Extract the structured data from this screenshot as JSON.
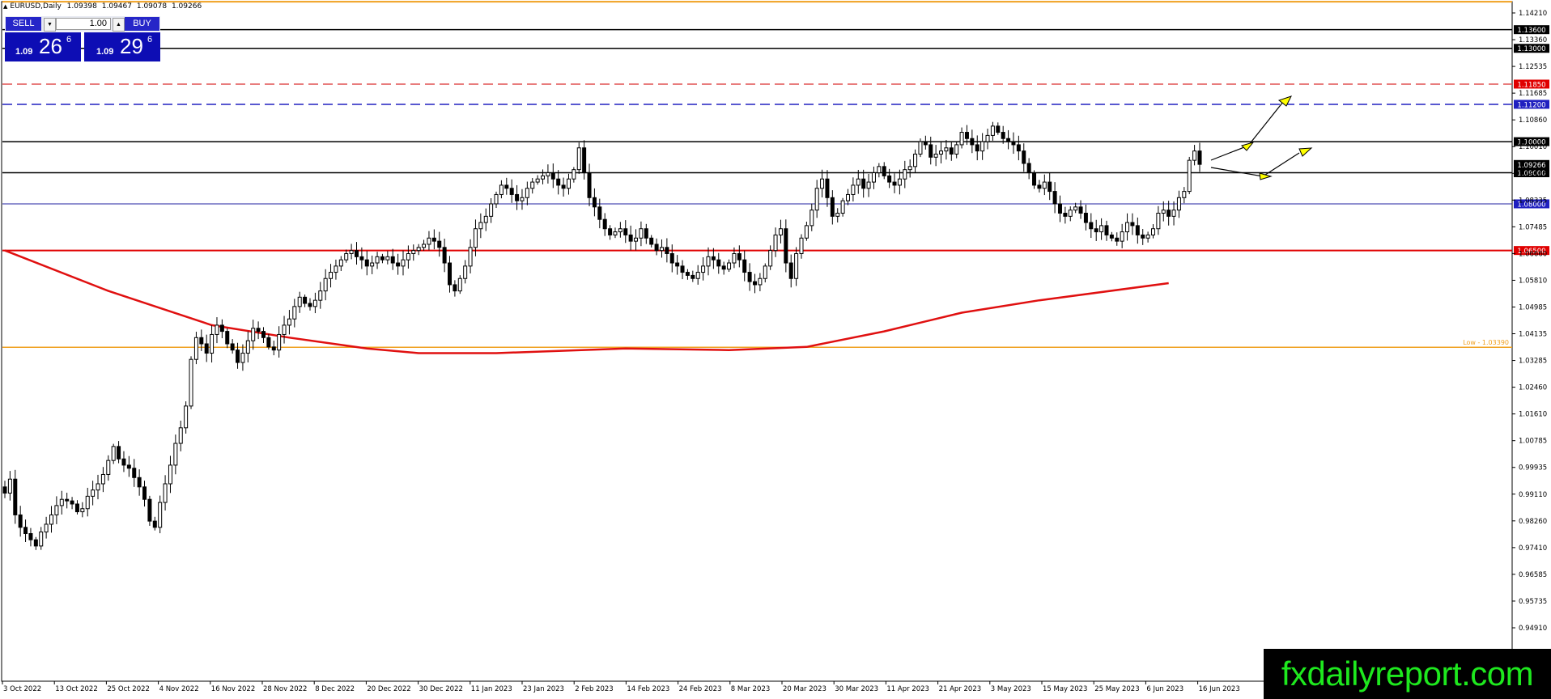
{
  "header": {
    "symbol": "EURUSD,Daily",
    "open": "1.09398",
    "high": "1.09467",
    "low": "1.09078",
    "close": "1.09266"
  },
  "trade_panel": {
    "sell_label": "SELL",
    "buy_label": "BUY",
    "lot_value": "1.00",
    "sell_big": "1.09",
    "sell_pips": "26",
    "sell_sup": "6",
    "buy_big": "1.09",
    "buy_pips": "29",
    "buy_sup": "6"
  },
  "watermark": "fxdailyreport.com",
  "colors": {
    "candle_up": "#ffffff",
    "candle_down": "#000000",
    "ma_line": "#e01010",
    "support_red": "#e00000",
    "dashed_red": "#e05050",
    "dashed_blue": "#2020c0",
    "blue_line": "#2020a0",
    "orange_line": "#f0a020",
    "arrow_fill": "#ffff00",
    "label_red": "#e00000",
    "label_blue": "#2020c0"
  },
  "chart_data": {
    "type": "candlestick",
    "ylim": [
      0.944,
      1.146
    ],
    "y_ticks": [
      "1.14210",
      "1.13360",
      "1.12535",
      "1.11685",
      "1.10860",
      "1.10010",
      "1.09185",
      "1.08335",
      "1.07485",
      "1.06660",
      "1.05810",
      "1.04985",
      "1.04135",
      "1.03285",
      "1.02460",
      "1.01610",
      "1.00785",
      "0.99935",
      "0.99110",
      "0.98260",
      "0.97410",
      "0.96585",
      "0.95735",
      "0.94910"
    ],
    "x_labels": [
      "3 Oct 2022",
      "13 Oct 2022",
      "25 Oct 2022",
      "4 Nov 2022",
      "16 Nov 2022",
      "28 Nov 2022",
      "8 Dec 2022",
      "20 Dec 2022",
      "30 Dec 2022",
      "11 Jan 2023",
      "23 Jan 2023",
      "2 Feb 2023",
      "14 Feb 2023",
      "24 Feb 2023",
      "8 Mar 2023",
      "20 Mar 2023",
      "30 Mar 2023",
      "11 Apr 2023",
      "21 Apr 2023",
      "3 May 2023",
      "15 May 2023",
      "25 May 2023",
      "6 Jun 2023",
      "16 Jun 2023"
    ],
    "levels": [
      {
        "value": 1.145,
        "label": "",
        "style": "orange-top"
      },
      {
        "value": 1.136,
        "label": "1.13600",
        "style": "black"
      },
      {
        "value": 1.13,
        "label": "1.13000",
        "style": "black"
      },
      {
        "value": 1.1185,
        "label": "1.11850",
        "style": "dashed-red"
      },
      {
        "value": 1.112,
        "label": "1.11200",
        "style": "dashed-blue"
      },
      {
        "value": 1.1,
        "label": "1.10000",
        "style": "black"
      },
      {
        "value": 1.09,
        "label": "1.09000",
        "style": "black"
      },
      {
        "value": 1.08,
        "label": "1.08000",
        "style": "blue"
      },
      {
        "value": 1.065,
        "label": "1.06500",
        "style": "red"
      },
      {
        "value": 1.0339,
        "label": "Low - 1.03390",
        "style": "orange"
      }
    ],
    "current_price": "1.09266",
    "current_price_value": 1.09266,
    "ma_line": [
      [
        0,
        1.065
      ],
      [
        20,
        1.052
      ],
      [
        40,
        1.041
      ],
      [
        55,
        1.037
      ],
      [
        70,
        1.0335
      ],
      [
        80,
        1.032
      ],
      [
        95,
        1.032
      ],
      [
        120,
        1.0335
      ],
      [
        140,
        1.033
      ],
      [
        155,
        1.034
      ],
      [
        170,
        1.039
      ],
      [
        185,
        1.045
      ],
      [
        200,
        1.049
      ],
      [
        225,
        1.0545
      ]
    ],
    "close_series": [
      0.987,
      0.9915,
      0.98,
      0.976,
      0.974,
      0.972,
      0.97,
      0.9745,
      0.977,
      0.98,
      0.983,
      0.985,
      0.9845,
      0.9835,
      0.981,
      0.982,
      0.986,
      0.988,
      0.99,
      0.993,
      0.9975,
      1.002,
      0.998,
      0.996,
      0.995,
      0.992,
      0.989,
      0.985,
      0.978,
      0.976,
      0.984,
      0.99,
      0.996,
      1.003,
      1.008,
      1.015,
      1.03,
      1.037,
      1.035,
      1.032,
      1.038,
      1.041,
      1.039,
      1.035,
      1.033,
      1.029,
      1.032,
      1.036,
      1.04,
      1.039,
      1.037,
      1.034,
      1.033,
      1.038,
      1.041,
      1.043,
      1.047,
      1.05,
      1.048,
      1.047,
      1.049,
      1.052,
      1.056,
      1.058,
      1.06,
      1.062,
      1.064,
      1.065,
      1.063,
      1.062,
      1.06,
      1.061,
      1.063,
      1.062,
      1.063,
      1.061,
      1.06,
      1.062,
      1.064,
      1.065,
      1.066,
      1.067,
      1.069,
      1.068,
      1.066,
      1.061,
      1.054,
      1.052,
      1.056,
      1.06,
      1.066,
      1.072,
      1.074,
      1.076,
      1.08,
      1.083,
      1.086,
      1.085,
      1.083,
      1.081,
      1.082,
      1.085,
      1.087,
      1.088,
      1.089,
      1.09,
      1.088,
      1.086,
      1.085,
      1.088,
      1.091,
      1.098,
      1.09,
      1.082,
      1.079,
      1.075,
      1.072,
      1.07,
      1.071,
      1.072,
      1.07,
      1.068,
      1.069,
      1.072,
      1.069,
      1.067,
      1.065,
      1.066,
      1.064,
      1.061,
      1.06,
      1.058,
      1.057,
      1.056,
      1.058,
      1.06,
      1.063,
      1.062,
      1.06,
      1.059,
      1.061,
      1.064,
      1.062,
      1.058,
      1.055,
      1.054,
      1.056,
      1.06,
      1.065,
      1.07,
      1.072,
      1.061,
      1.056,
      1.064,
      1.069,
      1.073,
      1.078,
      1.085,
      1.088,
      1.082,
      1.076,
      1.077,
      1.081,
      1.083,
      1.086,
      1.088,
      1.085,
      1.087,
      1.09,
      1.092,
      1.089,
      1.087,
      1.086,
      1.088,
      1.091,
      1.092,
      1.096,
      1.1,
      1.099,
      1.095,
      1.096,
      1.097,
      1.098,
      1.096,
      1.099,
      1.103,
      1.101,
      1.099,
      1.097,
      1.1,
      1.102,
      1.105,
      1.103,
      1.101,
      1.1,
      1.099,
      1.097,
      1.093,
      1.09,
      1.086,
      1.085,
      1.087,
      1.084,
      1.08,
      1.077,
      1.076,
      1.078,
      1.079,
      1.077,
      1.074,
      1.072,
      1.071,
      1.073,
      1.07,
      1.069,
      1.068,
      1.071,
      1.074,
      1.073,
      1.07,
      1.069,
      1.07,
      1.072,
      1.077,
      1.078,
      1.076,
      1.078,
      1.082,
      1.084,
      1.094,
      1.097,
      1.0927
    ]
  }
}
